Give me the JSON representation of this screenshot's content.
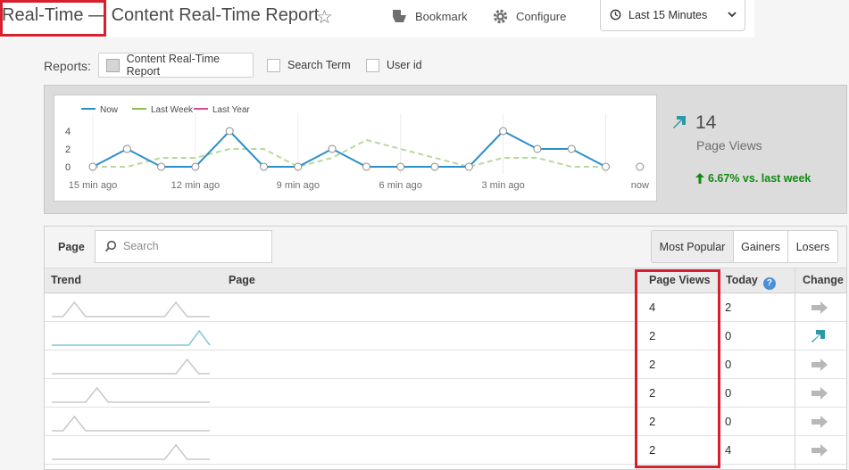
{
  "header": {
    "title": "Real-Time — Content Real-Time Report",
    "bookmark_label": "Bookmark",
    "configure_label": "Configure",
    "time_range": "Last 15 Minutes"
  },
  "reports": {
    "label": "Reports:",
    "items": [
      {
        "label": "Content Real-Time Report",
        "selected": true
      },
      {
        "label": "Search Term",
        "selected": false
      },
      {
        "label": "User id",
        "selected": false
      }
    ]
  },
  "chart_data": {
    "type": "line",
    "legend": [
      "Now",
      "Last Week",
      "Last Year"
    ],
    "legend_position": "top-left",
    "colors": {
      "Now": "#2d8fc9",
      "Last Week": "#8cc152",
      "Last Year": "#d94a9b"
    },
    "x_tick_labels": [
      "15 min ago",
      "12 min ago",
      "9 min ago",
      "6 min ago",
      "3 min ago",
      "now"
    ],
    "y_tick_labels": [
      "4",
      "2",
      "0"
    ],
    "ylim": [
      0,
      4
    ],
    "series": [
      {
        "name": "Now",
        "values": [
          0,
          2,
          0,
          0,
          4,
          0,
          0,
          2,
          0,
          0,
          0,
          0,
          4,
          2,
          2,
          0,
          null
        ]
      },
      {
        "name": "Last Week",
        "values": [
          0,
          0,
          1,
          1,
          2,
          2,
          0,
          1,
          3,
          2,
          1,
          0,
          1,
          1,
          0,
          0,
          null
        ]
      }
    ],
    "last_point_now": 0
  },
  "kpi": {
    "value": "14",
    "label": "Page Views",
    "change": "6.67% vs. last week"
  },
  "table": {
    "page_label": "Page",
    "search_placeholder": "Search",
    "filters": [
      "Most Popular",
      "Gainers",
      "Losers"
    ],
    "columns": {
      "trend": "Trend",
      "page": "Page",
      "page_views": "Page Views",
      "today": "Today",
      "change": "Change"
    },
    "rows": [
      {
        "trend": [
          0,
          0,
          1,
          0,
          0,
          0,
          0,
          0,
          0,
          0,
          0,
          1,
          0,
          0,
          0
        ],
        "page_views": "4",
        "today": "2",
        "change": "flat"
      },
      {
        "trend": [
          0,
          0,
          0,
          0,
          0,
          0,
          0,
          0,
          0,
          0,
          0,
          0,
          0,
          0,
          1,
          0
        ],
        "page_views": "2",
        "today": "0",
        "change": "up"
      },
      {
        "trend": [
          0,
          0,
          0,
          0,
          0,
          0,
          0,
          0,
          0,
          0,
          0,
          0,
          1,
          0,
          0
        ],
        "page_views": "2",
        "today": "0",
        "change": "flat"
      },
      {
        "trend": [
          0,
          0,
          0,
          0,
          1,
          0,
          0,
          0,
          0,
          0,
          0,
          0,
          0,
          0,
          0
        ],
        "page_views": "2",
        "today": "0",
        "change": "flat"
      },
      {
        "trend": [
          0,
          0,
          1,
          0,
          0,
          0,
          0,
          0,
          0,
          0,
          0,
          0,
          0,
          0,
          0
        ],
        "page_views": "2",
        "today": "0",
        "change": "flat"
      },
      {
        "trend": [
          0,
          0,
          0,
          0,
          0,
          0,
          0,
          0,
          0,
          0,
          0,
          1,
          0,
          0,
          0
        ],
        "page_views": "2",
        "today": "4",
        "change": "flat"
      }
    ]
  }
}
